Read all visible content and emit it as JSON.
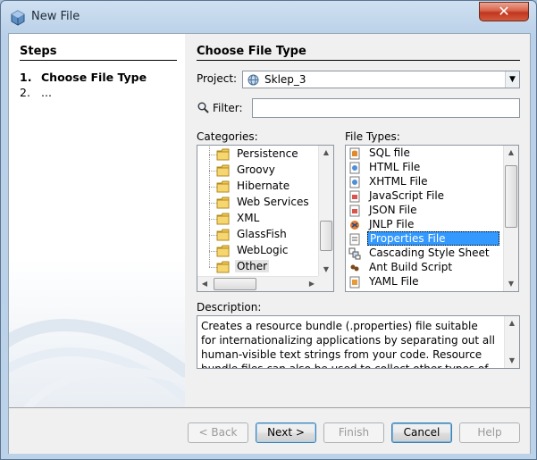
{
  "window": {
    "title": "New File",
    "close_label": "✕"
  },
  "steps": {
    "heading": "Steps",
    "items": [
      {
        "num": "1.",
        "label": "Choose File Type"
      },
      {
        "num": "2.",
        "label": "..."
      }
    ]
  },
  "main": {
    "title": "Choose File Type",
    "project_label": "Project:",
    "project_value": "Sklep_3",
    "filter_label": "Filter:",
    "filter_value": "",
    "categories_label": "Categories:",
    "categories": [
      "Persistence",
      "Groovy",
      "Hibernate",
      "Web Services",
      "XML",
      "GlassFish",
      "WebLogic",
      "Other"
    ],
    "selected_category": "Other",
    "file_types_label": "File Types:",
    "file_types": [
      "SQL file",
      "HTML File",
      "XHTML File",
      "JavaScript File",
      "JSON File",
      "JNLP File",
      "Properties File",
      "Cascading Style Sheet",
      "Ant Build Script",
      "YAML File"
    ],
    "selected_file_type": "Properties File",
    "description_label": "Description:",
    "description": "Creates a resource bundle (.properties) file suitable for internationalizing applications by separating out all human-visible text strings from your code. Resource bundle files can also be used to collect other types of"
  },
  "buttons": {
    "back": "< Back",
    "next": "Next >",
    "finish": "Finish",
    "cancel": "Cancel",
    "help": "Help"
  },
  "colors": {
    "selection": "#3399ff",
    "title_bar": "#b9d0e8",
    "close_button": "#c0361f"
  }
}
